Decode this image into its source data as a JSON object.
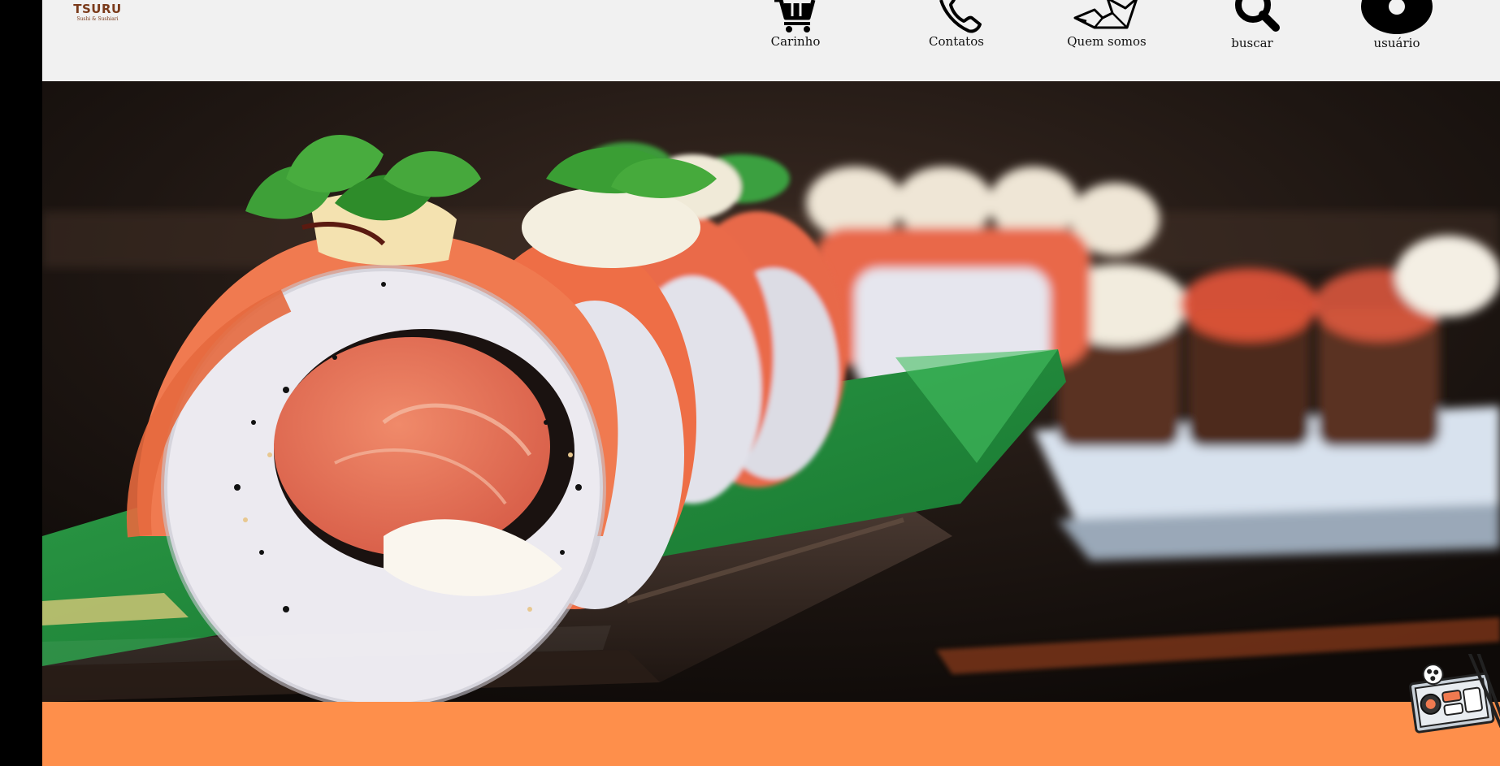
{
  "brand": {
    "name": "TSURU",
    "tagline": "Sushi & Sushiari"
  },
  "nav": {
    "cart": {
      "label": "Carinho",
      "icon": "cart-icon"
    },
    "contacts": {
      "label": "Contatos",
      "icon": "phone-icon"
    },
    "about": {
      "label": "Quem somos",
      "icon": "origami-crane-icon"
    },
    "search": {
      "label": "buscar",
      "icon": "search-icon"
    },
    "user": {
      "label": "usuário",
      "icon": "user-icon"
    }
  },
  "hero": {
    "image": "sushi-rolls-photo"
  },
  "colors": {
    "header_bg": "#f1f1f1",
    "accent_orange": "#fe8f4b",
    "brand_brown": "#7a3a1a",
    "side_bar": "#000000"
  }
}
